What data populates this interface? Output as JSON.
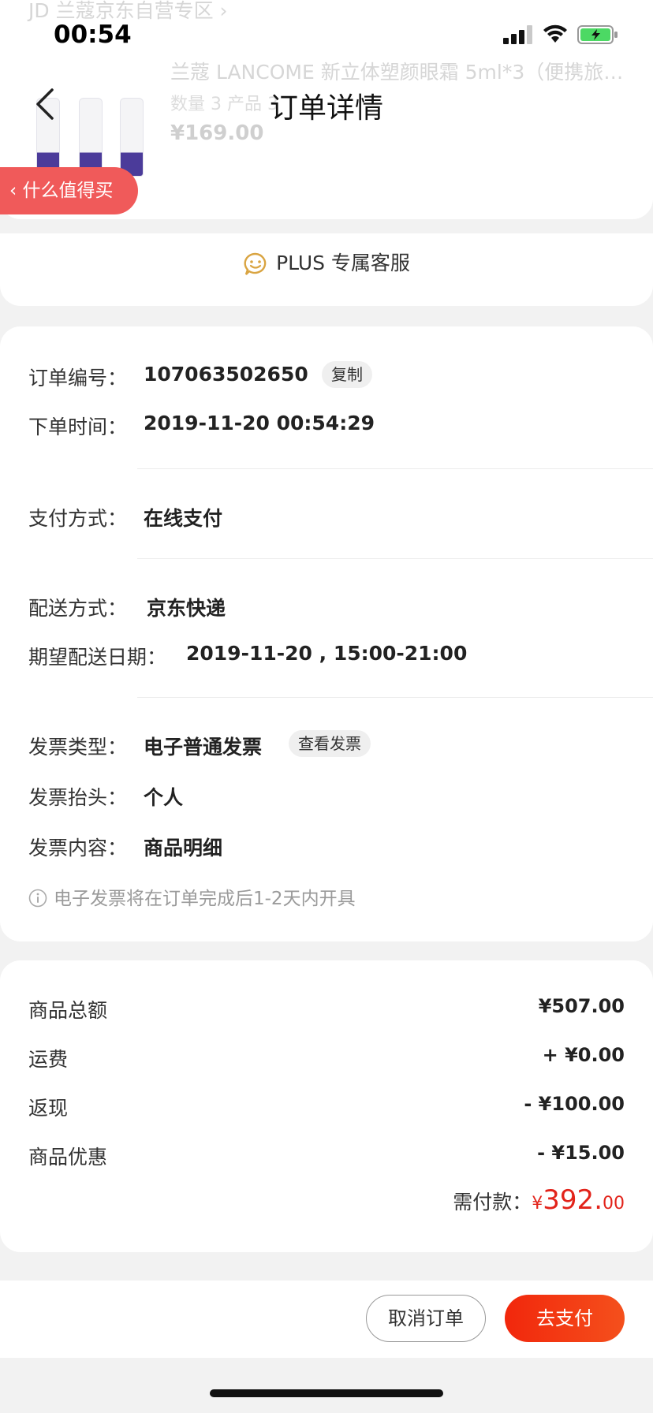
{
  "status_bar": {
    "time": "00:54",
    "battery_color": "#4cd964"
  },
  "product": {
    "store": "JD 兰蔻京东自营专区 ›",
    "title": "兰蔻 LANCOME 新立体塑颜眼霜 5ml*3（便携旅行…",
    "qty_line": "数量  3  产品        3",
    "price": "¥169.00"
  },
  "nav": {
    "title": "订单详情",
    "side_tag": "‹ 什么值得买"
  },
  "service": {
    "label": "PLUS 专属客服",
    "icon": "smile-chat-icon",
    "icon_color": "#d9a441"
  },
  "order": {
    "number_label": "订单编号：",
    "number": "107063502650",
    "copy_label": "复制",
    "time_label": "下单时间：",
    "time": "2019-11-20 00:54:29",
    "pay_method_label": "支付方式：",
    "pay_method": "在线支付",
    "delivery_label": "配送方式：",
    "delivery": "京东快递",
    "expected_label": "期望配送日期：",
    "expected": "2019-11-20 , 15:00-21:00",
    "invoice_type_label": "发票类型：",
    "invoice_type": "电子普通发票",
    "view_invoice_label": "查看发票",
    "invoice_title_label": "发票抬头：",
    "invoice_title": "个人",
    "invoice_content_label": "发票内容：",
    "invoice_content": "商品明细",
    "invoice_note": "电子发票将在订单完成后1-2天内开具"
  },
  "price": {
    "goods_total_label": "商品总额",
    "goods_total": "¥507.00",
    "shipping_label": "运费",
    "shipping": "+ ¥0.00",
    "cashback_label": "返现",
    "cashback": "- ¥100.00",
    "discount_label": "商品优惠",
    "discount": "- ¥15.00",
    "payable_label": "需付款：",
    "payable_currency": "¥",
    "payable_int": "392.",
    "payable_dec": "00",
    "accent_color": "#e2231a"
  },
  "actions": {
    "cancel": "取消订单",
    "pay": "去支付"
  }
}
